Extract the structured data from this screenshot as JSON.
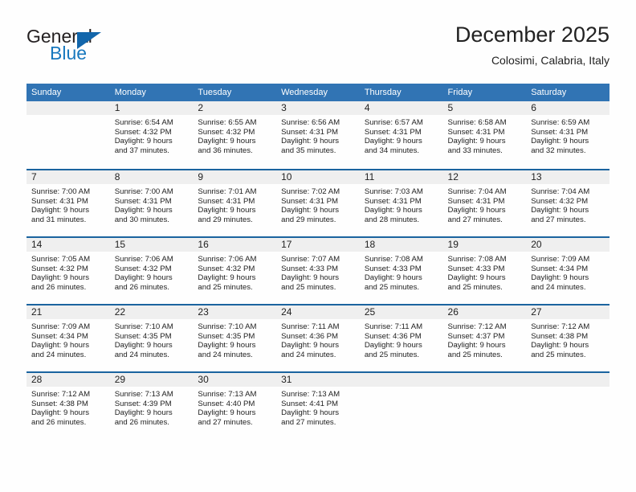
{
  "logo": {
    "word_top": "General",
    "word_bottom": "Blue",
    "triangle_color": "#1266ab",
    "blue_text_color": "#1878be"
  },
  "header": {
    "title": "December 2025",
    "subtitle": "Colosimi, Calabria, Italy"
  },
  "colors": {
    "header_blue": "#3174b4",
    "row_rule_blue": "#1b649f",
    "daynum_band": "#efefef",
    "page_bg": "#fefefe"
  },
  "calendar": {
    "weekday_headers": [
      "Sunday",
      "Monday",
      "Tuesday",
      "Wednesday",
      "Thursday",
      "Friday",
      "Saturday"
    ],
    "weeks": [
      [
        {
          "day": "",
          "empty": true,
          "sunrise": "",
          "sunset": "",
          "daylight_1": "",
          "daylight_2": ""
        },
        {
          "day": "1",
          "sunrise": "Sunrise: 6:54 AM",
          "sunset": "Sunset: 4:32 PM",
          "daylight_1": "Daylight: 9 hours",
          "daylight_2": "and 37 minutes."
        },
        {
          "day": "2",
          "sunrise": "Sunrise: 6:55 AM",
          "sunset": "Sunset: 4:32 PM",
          "daylight_1": "Daylight: 9 hours",
          "daylight_2": "and 36 minutes."
        },
        {
          "day": "3",
          "sunrise": "Sunrise: 6:56 AM",
          "sunset": "Sunset: 4:31 PM",
          "daylight_1": "Daylight: 9 hours",
          "daylight_2": "and 35 minutes."
        },
        {
          "day": "4",
          "sunrise": "Sunrise: 6:57 AM",
          "sunset": "Sunset: 4:31 PM",
          "daylight_1": "Daylight: 9 hours",
          "daylight_2": "and 34 minutes."
        },
        {
          "day": "5",
          "sunrise": "Sunrise: 6:58 AM",
          "sunset": "Sunset: 4:31 PM",
          "daylight_1": "Daylight: 9 hours",
          "daylight_2": "and 33 minutes."
        },
        {
          "day": "6",
          "sunrise": "Sunrise: 6:59 AM",
          "sunset": "Sunset: 4:31 PM",
          "daylight_1": "Daylight: 9 hours",
          "daylight_2": "and 32 minutes."
        }
      ],
      [
        {
          "day": "7",
          "sunrise": "Sunrise: 7:00 AM",
          "sunset": "Sunset: 4:31 PM",
          "daylight_1": "Daylight: 9 hours",
          "daylight_2": "and 31 minutes."
        },
        {
          "day": "8",
          "sunrise": "Sunrise: 7:00 AM",
          "sunset": "Sunset: 4:31 PM",
          "daylight_1": "Daylight: 9 hours",
          "daylight_2": "and 30 minutes."
        },
        {
          "day": "9",
          "sunrise": "Sunrise: 7:01 AM",
          "sunset": "Sunset: 4:31 PM",
          "daylight_1": "Daylight: 9 hours",
          "daylight_2": "and 29 minutes."
        },
        {
          "day": "10",
          "sunrise": "Sunrise: 7:02 AM",
          "sunset": "Sunset: 4:31 PM",
          "daylight_1": "Daylight: 9 hours",
          "daylight_2": "and 29 minutes."
        },
        {
          "day": "11",
          "sunrise": "Sunrise: 7:03 AM",
          "sunset": "Sunset: 4:31 PM",
          "daylight_1": "Daylight: 9 hours",
          "daylight_2": "and 28 minutes."
        },
        {
          "day": "12",
          "sunrise": "Sunrise: 7:04 AM",
          "sunset": "Sunset: 4:31 PM",
          "daylight_1": "Daylight: 9 hours",
          "daylight_2": "and 27 minutes."
        },
        {
          "day": "13",
          "sunrise": "Sunrise: 7:04 AM",
          "sunset": "Sunset: 4:32 PM",
          "daylight_1": "Daylight: 9 hours",
          "daylight_2": "and 27 minutes."
        }
      ],
      [
        {
          "day": "14",
          "sunrise": "Sunrise: 7:05 AM",
          "sunset": "Sunset: 4:32 PM",
          "daylight_1": "Daylight: 9 hours",
          "daylight_2": "and 26 minutes."
        },
        {
          "day": "15",
          "sunrise": "Sunrise: 7:06 AM",
          "sunset": "Sunset: 4:32 PM",
          "daylight_1": "Daylight: 9 hours",
          "daylight_2": "and 26 minutes."
        },
        {
          "day": "16",
          "sunrise": "Sunrise: 7:06 AM",
          "sunset": "Sunset: 4:32 PM",
          "daylight_1": "Daylight: 9 hours",
          "daylight_2": "and 25 minutes."
        },
        {
          "day": "17",
          "sunrise": "Sunrise: 7:07 AM",
          "sunset": "Sunset: 4:33 PM",
          "daylight_1": "Daylight: 9 hours",
          "daylight_2": "and 25 minutes."
        },
        {
          "day": "18",
          "sunrise": "Sunrise: 7:08 AM",
          "sunset": "Sunset: 4:33 PM",
          "daylight_1": "Daylight: 9 hours",
          "daylight_2": "and 25 minutes."
        },
        {
          "day": "19",
          "sunrise": "Sunrise: 7:08 AM",
          "sunset": "Sunset: 4:33 PM",
          "daylight_1": "Daylight: 9 hours",
          "daylight_2": "and 25 minutes."
        },
        {
          "day": "20",
          "sunrise": "Sunrise: 7:09 AM",
          "sunset": "Sunset: 4:34 PM",
          "daylight_1": "Daylight: 9 hours",
          "daylight_2": "and 24 minutes."
        }
      ],
      [
        {
          "day": "21",
          "sunrise": "Sunrise: 7:09 AM",
          "sunset": "Sunset: 4:34 PM",
          "daylight_1": "Daylight: 9 hours",
          "daylight_2": "and 24 minutes."
        },
        {
          "day": "22",
          "sunrise": "Sunrise: 7:10 AM",
          "sunset": "Sunset: 4:35 PM",
          "daylight_1": "Daylight: 9 hours",
          "daylight_2": "and 24 minutes."
        },
        {
          "day": "23",
          "sunrise": "Sunrise: 7:10 AM",
          "sunset": "Sunset: 4:35 PM",
          "daylight_1": "Daylight: 9 hours",
          "daylight_2": "and 24 minutes."
        },
        {
          "day": "24",
          "sunrise": "Sunrise: 7:11 AM",
          "sunset": "Sunset: 4:36 PM",
          "daylight_1": "Daylight: 9 hours",
          "daylight_2": "and 24 minutes."
        },
        {
          "day": "25",
          "sunrise": "Sunrise: 7:11 AM",
          "sunset": "Sunset: 4:36 PM",
          "daylight_1": "Daylight: 9 hours",
          "daylight_2": "and 25 minutes."
        },
        {
          "day": "26",
          "sunrise": "Sunrise: 7:12 AM",
          "sunset": "Sunset: 4:37 PM",
          "daylight_1": "Daylight: 9 hours",
          "daylight_2": "and 25 minutes."
        },
        {
          "day": "27",
          "sunrise": "Sunrise: 7:12 AM",
          "sunset": "Sunset: 4:38 PM",
          "daylight_1": "Daylight: 9 hours",
          "daylight_2": "and 25 minutes."
        }
      ],
      [
        {
          "day": "28",
          "sunrise": "Sunrise: 7:12 AM",
          "sunset": "Sunset: 4:38 PM",
          "daylight_1": "Daylight: 9 hours",
          "daylight_2": "and 26 minutes."
        },
        {
          "day": "29",
          "sunrise": "Sunrise: 7:13 AM",
          "sunset": "Sunset: 4:39 PM",
          "daylight_1": "Daylight: 9 hours",
          "daylight_2": "and 26 minutes."
        },
        {
          "day": "30",
          "sunrise": "Sunrise: 7:13 AM",
          "sunset": "Sunset: 4:40 PM",
          "daylight_1": "Daylight: 9 hours",
          "daylight_2": "and 27 minutes."
        },
        {
          "day": "31",
          "sunrise": "Sunrise: 7:13 AM",
          "sunset": "Sunset: 4:41 PM",
          "daylight_1": "Daylight: 9 hours",
          "daylight_2": "and 27 minutes."
        },
        {
          "day": "",
          "empty": true,
          "sunrise": "",
          "sunset": "",
          "daylight_1": "",
          "daylight_2": ""
        },
        {
          "day": "",
          "empty": true,
          "sunrise": "",
          "sunset": "",
          "daylight_1": "",
          "daylight_2": ""
        },
        {
          "day": "",
          "empty": true,
          "sunrise": "",
          "sunset": "",
          "daylight_1": "",
          "daylight_2": ""
        }
      ]
    ]
  }
}
